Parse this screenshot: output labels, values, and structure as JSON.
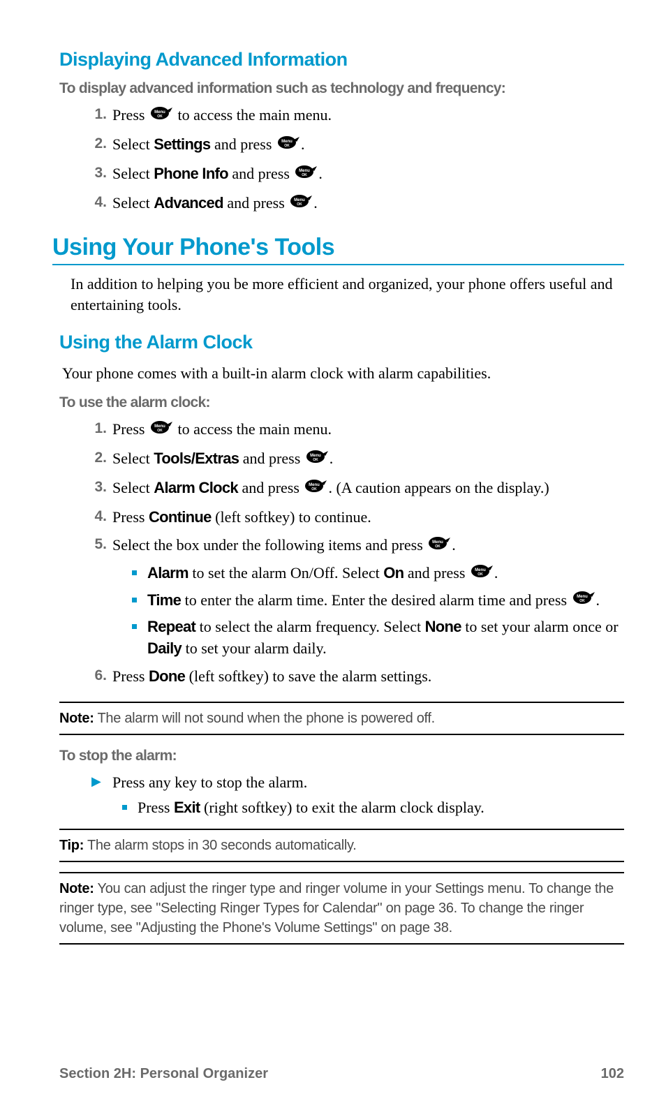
{
  "s1": {
    "heading": "Displaying Advanced Information",
    "intro": "To display advanced information such as technology and frequency:",
    "li1a": "Press ",
    "li1b": " to access the main menu.",
    "li2a": "Select ",
    "li2b": "Settings",
    "li2c": " and press ",
    "li3a": "Select ",
    "li3b": "Phone Info",
    "li3c": " and press ",
    "li4a": "Select ",
    "li4b": "Advanced",
    "li4c": " and press "
  },
  "s2": {
    "heading": "Using Your Phone's Tools",
    "intro": "In addition to helping you be more efficient and organized, your phone offers useful and entertaining tools."
  },
  "s3": {
    "heading": "Using the Alarm Clock",
    "intro": "Your phone comes with a built-in alarm clock with alarm capabilities.",
    "toUseLabel": "To use the alarm clock:",
    "li1a": "Press ",
    "li1b": " to access the main menu.",
    "li2a": "Select ",
    "li2b": "Tools/Extras",
    "li2c": " and press ",
    "li3a": "Select ",
    "li3b": "Alarm Clock",
    "li3c": " and press ",
    "li3d": ". (A caution appears on the display.)",
    "li4a": "Press ",
    "li4b": "Continue",
    "li4c": " (left softkey) to continue.",
    "li5a": "Select the box under the following items and press ",
    "sub1a": "Alarm",
    "sub1b": " to set the alarm On/Off. Select ",
    "sub1c": "On",
    "sub1d": " and press ",
    "sub2a": "Time",
    "sub2b": " to enter the alarm time. Enter the desired alarm time and press ",
    "sub3a": "Repeat",
    "sub3b": " to select the alarm frequency. Select ",
    "sub3c": "None",
    "sub3d": " to set your alarm once or ",
    "sub3e": "Daily",
    "sub3f": " to set your alarm daily.",
    "li6a": "Press ",
    "li6b": "Done",
    "li6c": " (left softkey) to save the alarm settings."
  },
  "note1": {
    "label": "Note:",
    "text": " The alarm will not sound when the phone is powered off."
  },
  "s4": {
    "toStopLabel": "To stop the alarm:",
    "arrow1": "Press any key to stop the alarm.",
    "sub1a": "Press ",
    "sub1b": "Exit",
    "sub1c": " (right softkey) to exit the alarm clock display."
  },
  "tip1": {
    "label": "Tip:",
    "text": " The alarm stops in 30 seconds automatically."
  },
  "note2": {
    "label": "Note:",
    "text": " You can adjust the ringer type and ringer volume in your Settings menu. To change the ringer type, see \"Selecting Ringer Types for Calendar\" on page 36. To change the ringer volume, see \"Adjusting the Phone's Volume Settings\" on page 38."
  },
  "footer": {
    "section": "Section 2H: Personal Organizer",
    "page": "102"
  }
}
